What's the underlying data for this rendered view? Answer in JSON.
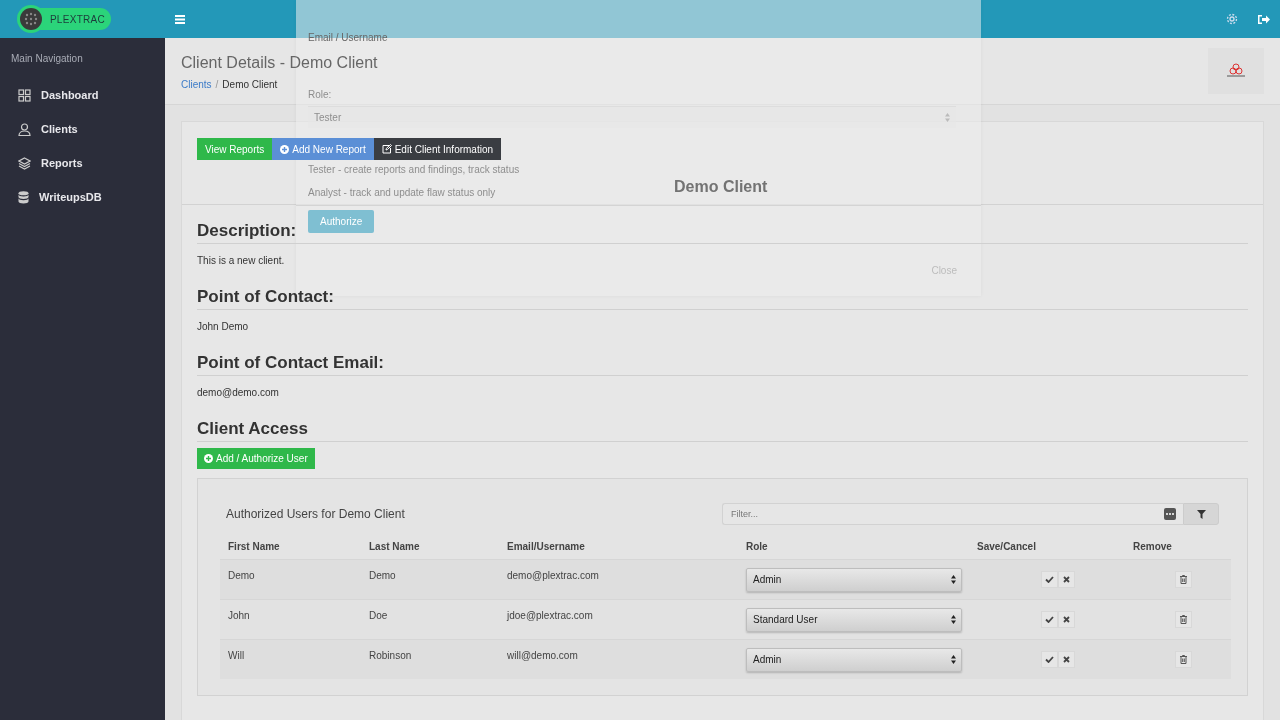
{
  "header": {
    "brand": "PLEXTRAC"
  },
  "sidebar": {
    "heading": "Main Navigation",
    "items": [
      {
        "label": "Dashboard"
      },
      {
        "label": "Clients"
      },
      {
        "label": "Reports"
      },
      {
        "label": "WriteupsDB"
      }
    ]
  },
  "page": {
    "title": "Client Details - Demo Client",
    "breadcrumbs": [
      {
        "label": "Clients",
        "kind": "link"
      },
      {
        "label": "/",
        "kind": "separator"
      },
      {
        "label": "Demo Client",
        "kind": "current"
      }
    ]
  },
  "actions": [
    {
      "label": "View Reports",
      "kind": "success"
    },
    {
      "label": "Add New Report",
      "kind": "primary"
    },
    {
      "label": "Edit Client Information",
      "kind": "dark"
    }
  ],
  "sections": [
    {
      "heading": "Description:",
      "text": "This is a new client."
    },
    {
      "heading": "Point of Contact:",
      "text": "John Demo"
    },
    {
      "heading": "Point of Contact Email:",
      "text": "demo@demo.com"
    }
  ],
  "client_access": {
    "heading": "Client Access",
    "add_button": "Add / Authorize User",
    "panel_title": "Authorized Users for Demo Client",
    "filter": {
      "placeholder": "Filter..."
    },
    "columns": [
      "First Name",
      "Last Name",
      "Email/Username",
      "Role",
      "Save/Cancel",
      "Remove"
    ],
    "rows": [
      {
        "first_name": "Demo",
        "last_name": "Demo",
        "email": "demo@plextrac.com",
        "role": "Admin"
      },
      {
        "first_name": "John",
        "last_name": "Doe",
        "email": "jdoe@plextrac.com",
        "role": "Standard User"
      },
      {
        "first_name": "Will",
        "last_name": "Robinson",
        "email": "will@demo.com",
        "role": "Admin"
      }
    ]
  },
  "modal": {
    "email_label": "Email / Username",
    "role_label": "Role:",
    "role_value": "Tester",
    "role_help": [
      "Tester - create reports and findings, track status",
      "Analyst - track and update flaw status only"
    ],
    "authorize_button": "Authorize",
    "heading": "Demo Client",
    "close_button": "Close"
  }
}
